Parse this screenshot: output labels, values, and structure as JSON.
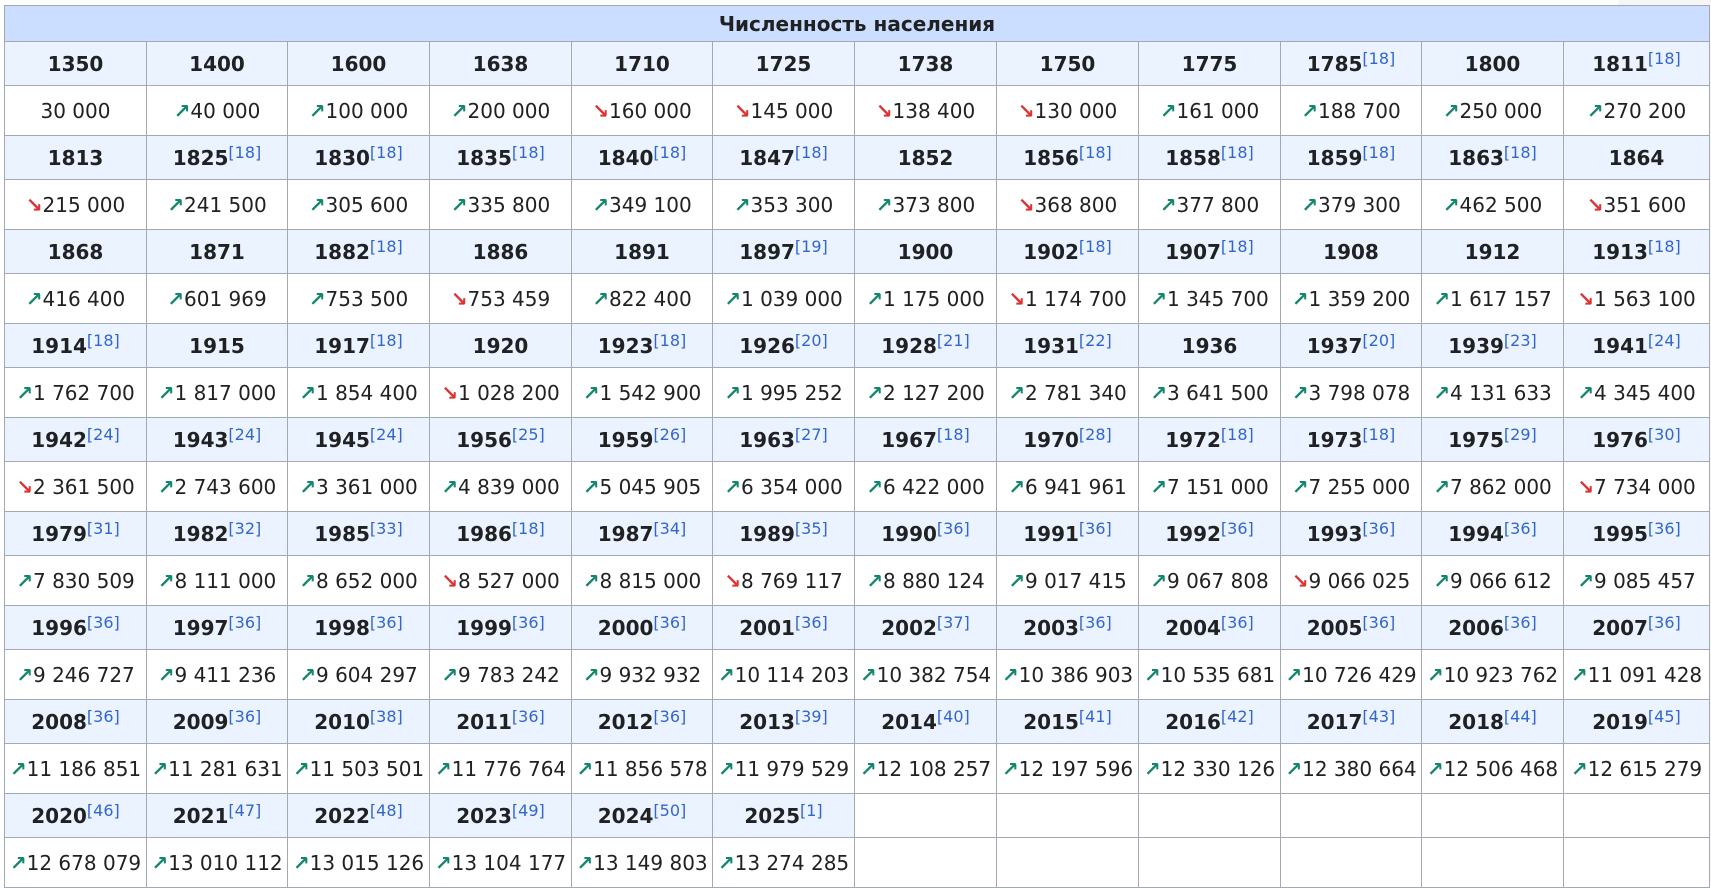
{
  "title": "Численность населения",
  "colors": {
    "up": "#14866d",
    "down": "#dd3333",
    "ref": "#3366cc",
    "header": "#ccdeff",
    "year_row": "#eaf3ff"
  },
  "rows": [
    {
      "years": [
        [
          "1350",
          ""
        ],
        [
          "1400",
          ""
        ],
        [
          "1600",
          ""
        ],
        [
          "1638",
          ""
        ],
        [
          "1710",
          ""
        ],
        [
          "1725",
          ""
        ],
        [
          "1738",
          ""
        ],
        [
          "1750",
          ""
        ],
        [
          "1775",
          ""
        ],
        [
          "1785",
          "[18]"
        ],
        [
          "1800",
          ""
        ],
        [
          "1811",
          "[18]"
        ]
      ],
      "values": [
        [
          "",
          "30 000"
        ],
        [
          "↗",
          "40 000"
        ],
        [
          "↗",
          "100 000"
        ],
        [
          "↗",
          "200 000"
        ],
        [
          "↘",
          "160 000"
        ],
        [
          "↘",
          "145 000"
        ],
        [
          "↘",
          "138 400"
        ],
        [
          "↘",
          "130 000"
        ],
        [
          "↗",
          "161 000"
        ],
        [
          "↗",
          "188 700"
        ],
        [
          "↗",
          "250 000"
        ],
        [
          "↗",
          "270 200"
        ]
      ]
    },
    {
      "years": [
        [
          "1813",
          ""
        ],
        [
          "1825",
          "[18]"
        ],
        [
          "1830",
          "[18]"
        ],
        [
          "1835",
          "[18]"
        ],
        [
          "1840",
          "[18]"
        ],
        [
          "1847",
          "[18]"
        ],
        [
          "1852",
          ""
        ],
        [
          "1856",
          "[18]"
        ],
        [
          "1858",
          "[18]"
        ],
        [
          "1859",
          "[18]"
        ],
        [
          "1863",
          "[18]"
        ],
        [
          "1864",
          ""
        ]
      ],
      "values": [
        [
          "↘",
          "215 000"
        ],
        [
          "↗",
          "241 500"
        ],
        [
          "↗",
          "305 600"
        ],
        [
          "↗",
          "335 800"
        ],
        [
          "↗",
          "349 100"
        ],
        [
          "↗",
          "353 300"
        ],
        [
          "↗",
          "373 800"
        ],
        [
          "↘",
          "368 800"
        ],
        [
          "↗",
          "377 800"
        ],
        [
          "↗",
          "379 300"
        ],
        [
          "↗",
          "462 500"
        ],
        [
          "↘",
          "351 600"
        ]
      ]
    },
    {
      "years": [
        [
          "1868",
          ""
        ],
        [
          "1871",
          ""
        ],
        [
          "1882",
          "[18]"
        ],
        [
          "1886",
          ""
        ],
        [
          "1891",
          ""
        ],
        [
          "1897",
          "[19]"
        ],
        [
          "1900",
          ""
        ],
        [
          "1902",
          "[18]"
        ],
        [
          "1907",
          "[18]"
        ],
        [
          "1908",
          ""
        ],
        [
          "1912",
          ""
        ],
        [
          "1913",
          "[18]"
        ]
      ],
      "values": [
        [
          "↗",
          "416 400"
        ],
        [
          "↗",
          "601 969"
        ],
        [
          "↗",
          "753 500"
        ],
        [
          "↘",
          "753 459"
        ],
        [
          "↗",
          "822 400"
        ],
        [
          "↗",
          "1 039 000"
        ],
        [
          "↗",
          "1 175 000"
        ],
        [
          "↘",
          "1 174 700"
        ],
        [
          "↗",
          "1 345 700"
        ],
        [
          "↗",
          "1 359 200"
        ],
        [
          "↗",
          "1 617 157"
        ],
        [
          "↘",
          "1 563 100"
        ]
      ]
    },
    {
      "years": [
        [
          "1914",
          "[18]"
        ],
        [
          "1915",
          ""
        ],
        [
          "1917",
          "[18]"
        ],
        [
          "1920",
          ""
        ],
        [
          "1923",
          "[18]"
        ],
        [
          "1926",
          "[20]"
        ],
        [
          "1928",
          "[21]"
        ],
        [
          "1931",
          "[22]"
        ],
        [
          "1936",
          ""
        ],
        [
          "1937",
          "[20]"
        ],
        [
          "1939",
          "[23]"
        ],
        [
          "1941",
          "[24]"
        ]
      ],
      "values": [
        [
          "↗",
          "1 762 700"
        ],
        [
          "↗",
          "1 817 000"
        ],
        [
          "↗",
          "1 854 400"
        ],
        [
          "↘",
          "1 028 200"
        ],
        [
          "↗",
          "1 542 900"
        ],
        [
          "↗",
          "1 995 252"
        ],
        [
          "↗",
          "2 127 200"
        ],
        [
          "↗",
          "2 781 340"
        ],
        [
          "↗",
          "3 641 500"
        ],
        [
          "↗",
          "3 798 078"
        ],
        [
          "↗",
          "4 131 633"
        ],
        [
          "↗",
          "4 345 400"
        ]
      ]
    },
    {
      "years": [
        [
          "1942",
          "[24]"
        ],
        [
          "1943",
          "[24]"
        ],
        [
          "1945",
          "[24]"
        ],
        [
          "1956",
          "[25]"
        ],
        [
          "1959",
          "[26]"
        ],
        [
          "1963",
          "[27]"
        ],
        [
          "1967",
          "[18]"
        ],
        [
          "1970",
          "[28]"
        ],
        [
          "1972",
          "[18]"
        ],
        [
          "1973",
          "[18]"
        ],
        [
          "1975",
          "[29]"
        ],
        [
          "1976",
          "[30]"
        ]
      ],
      "values": [
        [
          "↘",
          "2 361 500"
        ],
        [
          "↗",
          "2 743 600"
        ],
        [
          "↗",
          "3 361 000"
        ],
        [
          "↗",
          "4 839 000"
        ],
        [
          "↗",
          "5 045 905"
        ],
        [
          "↗",
          "6 354 000"
        ],
        [
          "↗",
          "6 422 000"
        ],
        [
          "↗",
          "6 941 961"
        ],
        [
          "↗",
          "7 151 000"
        ],
        [
          "↗",
          "7 255 000"
        ],
        [
          "↗",
          "7 862 000"
        ],
        [
          "↘",
          "7 734 000"
        ]
      ]
    },
    {
      "years": [
        [
          "1979",
          "[31]"
        ],
        [
          "1982",
          "[32]"
        ],
        [
          "1985",
          "[33]"
        ],
        [
          "1986",
          "[18]"
        ],
        [
          "1987",
          "[34]"
        ],
        [
          "1989",
          "[35]"
        ],
        [
          "1990",
          "[36]"
        ],
        [
          "1991",
          "[36]"
        ],
        [
          "1992",
          "[36]"
        ],
        [
          "1993",
          "[36]"
        ],
        [
          "1994",
          "[36]"
        ],
        [
          "1995",
          "[36]"
        ]
      ],
      "values": [
        [
          "↗",
          "7 830 509"
        ],
        [
          "↗",
          "8 111 000"
        ],
        [
          "↗",
          "8 652 000"
        ],
        [
          "↘",
          "8 527 000"
        ],
        [
          "↗",
          "8 815 000"
        ],
        [
          "↘",
          "8 769 117"
        ],
        [
          "↗",
          "8 880 124"
        ],
        [
          "↗",
          "9 017 415"
        ],
        [
          "↗",
          "9 067 808"
        ],
        [
          "↘",
          "9 066 025"
        ],
        [
          "↗",
          "9 066 612"
        ],
        [
          "↗",
          "9 085 457"
        ]
      ]
    },
    {
      "years": [
        [
          "1996",
          "[36]"
        ],
        [
          "1997",
          "[36]"
        ],
        [
          "1998",
          "[36]"
        ],
        [
          "1999",
          "[36]"
        ],
        [
          "2000",
          "[36]"
        ],
        [
          "2001",
          "[36]"
        ],
        [
          "2002",
          "[37]"
        ],
        [
          "2003",
          "[36]"
        ],
        [
          "2004",
          "[36]"
        ],
        [
          "2005",
          "[36]"
        ],
        [
          "2006",
          "[36]"
        ],
        [
          "2007",
          "[36]"
        ]
      ],
      "values": [
        [
          "↗",
          "9 246 727"
        ],
        [
          "↗",
          "9 411 236"
        ],
        [
          "↗",
          "9 604 297"
        ],
        [
          "↗",
          "9 783 242"
        ],
        [
          "↗",
          "9 932 932"
        ],
        [
          "↗",
          "10 114 203"
        ],
        [
          "↗",
          "10 382 754"
        ],
        [
          "↗",
          "10 386 903"
        ],
        [
          "↗",
          "10 535 681"
        ],
        [
          "↗",
          "10 726 429"
        ],
        [
          "↗",
          "10 923 762"
        ],
        [
          "↗",
          "11 091 428"
        ]
      ]
    },
    {
      "years": [
        [
          "2008",
          "[36]"
        ],
        [
          "2009",
          "[36]"
        ],
        [
          "2010",
          "[38]"
        ],
        [
          "2011",
          "[36]"
        ],
        [
          "2012",
          "[36]"
        ],
        [
          "2013",
          "[39]"
        ],
        [
          "2014",
          "[40]"
        ],
        [
          "2015",
          "[41]"
        ],
        [
          "2016",
          "[42]"
        ],
        [
          "2017",
          "[43]"
        ],
        [
          "2018",
          "[44]"
        ],
        [
          "2019",
          "[45]"
        ]
      ],
      "values": [
        [
          "↗",
          "11 186 851"
        ],
        [
          "↗",
          "11 281 631"
        ],
        [
          "↗",
          "11 503 501"
        ],
        [
          "↗",
          "11 776 764"
        ],
        [
          "↗",
          "11 856 578"
        ],
        [
          "↗",
          "11 979 529"
        ],
        [
          "↗",
          "12 108 257"
        ],
        [
          "↗",
          "12 197 596"
        ],
        [
          "↗",
          "12 330 126"
        ],
        [
          "↗",
          "12 380 664"
        ],
        [
          "↗",
          "12 506 468"
        ],
        [
          "↗",
          "12 615 279"
        ]
      ]
    },
    {
      "years": [
        [
          "2020",
          "[46]"
        ],
        [
          "2021",
          "[47]"
        ],
        [
          "2022",
          "[48]"
        ],
        [
          "2023",
          "[49]"
        ],
        [
          "2024",
          "[50]"
        ],
        [
          "2025",
          "[1]"
        ]
      ],
      "values": [
        [
          "↗",
          "12 678 079"
        ],
        [
          "↗",
          "13 010 112"
        ],
        [
          "↗",
          "13 015 126"
        ],
        [
          "↗",
          "13 104 177"
        ],
        [
          "↗",
          "13 149 803"
        ],
        [
          "↗",
          "13 274 285"
        ]
      ]
    }
  ]
}
